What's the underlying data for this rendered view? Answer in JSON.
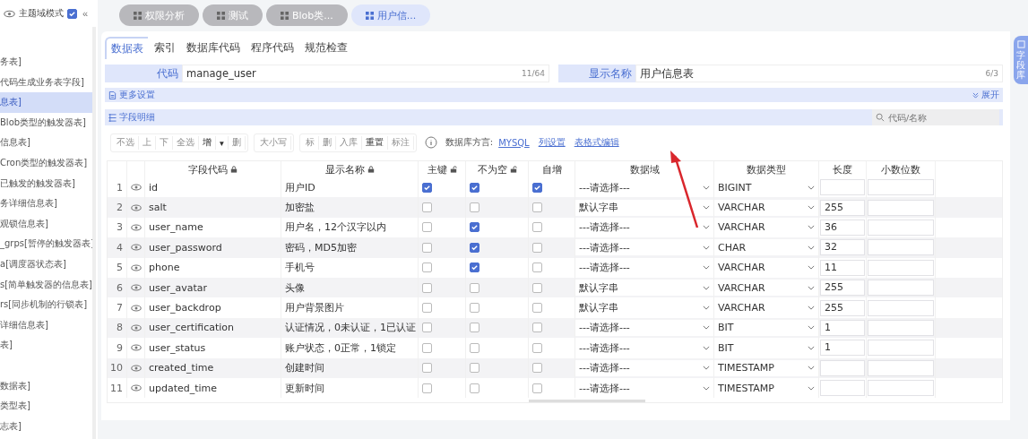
{
  "sidebar": {
    "header": {
      "label": "主题域模式",
      "checked": true,
      "collapse": "«"
    },
    "items": [
      {
        "label": "务表]",
        "selected": false
      },
      {
        "label": "代码生成业务表字段]",
        "selected": false
      },
      {
        "label": "息表]",
        "selected": true
      },
      {
        "label": "Blob类型的触发器表]",
        "selected": false
      },
      {
        "label": "信息表]",
        "selected": false
      },
      {
        "label": "Cron类型的触发器表]",
        "selected": false
      },
      {
        "label": "已触发的触发器表]",
        "selected": false
      },
      {
        "label": "务详细信息表]",
        "selected": false
      },
      {
        "label": "观锁信息表]",
        "selected": false
      },
      {
        "label": "_grps[暂停的触发器表]",
        "selected": false
      },
      {
        "label": "a[调度器状态表]",
        "selected": false
      },
      {
        "label": "s[简单触发器的信息表]",
        "selected": false
      },
      {
        "label": "rs[同步机制的行锁表]",
        "selected": false
      },
      {
        "label": "详细信息表]",
        "selected": false
      },
      {
        "label": "表]",
        "selected": false
      }
    ],
    "lower_items": [
      {
        "label": "数据表]",
        "selected": false
      },
      {
        "label": "类型表]",
        "selected": false
      },
      {
        "label": "志表]",
        "selected": false
      }
    ]
  },
  "open_tabs": [
    {
      "label": "权限分析",
      "selected": false
    },
    {
      "label": "测试",
      "selected": false
    },
    {
      "label": "Blob类...",
      "selected": false
    },
    {
      "label": "用户信...",
      "selected": true
    }
  ],
  "sub_tabs": [
    {
      "label": "数据表",
      "selected": true
    },
    {
      "label": "索引",
      "selected": false
    },
    {
      "label": "数据库代码",
      "selected": false
    },
    {
      "label": "程序代码",
      "selected": false
    },
    {
      "label": "规范检查",
      "selected": false
    }
  ],
  "form": [
    {
      "label": "代码",
      "value": "manage_user",
      "counter": "11/64"
    },
    {
      "label": "显示名称",
      "value": "用户信息表",
      "counter": "6/3"
    }
  ],
  "side_tab": {
    "label": "字段库"
  },
  "more_settings": {
    "label": "更多设置",
    "expand": "展开"
  },
  "field_details": {
    "label": "字段明细",
    "search_placeholder": "代码/名称"
  },
  "toolbar": {
    "groups": [
      [
        {
          "label": "不选",
          "disabled": true
        },
        {
          "label": "上",
          "disabled": true
        },
        {
          "label": "下",
          "disabled": true
        },
        {
          "label": "全选",
          "disabled": true
        },
        {
          "label": "增",
          "disabled": false
        },
        {
          "label": "▾",
          "disabled": false
        },
        {
          "label": "删",
          "disabled": true
        }
      ],
      [
        {
          "label": "大小写",
          "disabled": true
        }
      ],
      [
        {
          "label": "标",
          "disabled": true
        },
        {
          "label": "删",
          "disabled": true
        },
        {
          "label": "入库",
          "disabled": true
        },
        {
          "label": "重置",
          "disabled": false
        },
        {
          "label": "标注",
          "disabled": true
        }
      ]
    ],
    "dialect_label": "数据库方言:",
    "dialect": "MYSQL",
    "links": [
      "列设置",
      "表格式编辑"
    ]
  },
  "table": {
    "columns": [
      "字段代码",
      "显示名称",
      "主键",
      "不为空",
      "自增",
      "数据域",
      "数据类型",
      "长度",
      "小数位数"
    ],
    "rows": [
      {
        "no": "1",
        "code": "id",
        "name": "用户ID",
        "pk": true,
        "not_null": true,
        "auto_inc": true,
        "domain": "---请选择---",
        "type": "BIGINT",
        "length": ""
      },
      {
        "no": "2",
        "code": "salt",
        "name": "加密盐",
        "pk": false,
        "not_null": false,
        "auto_inc": false,
        "domain": "默认字串",
        "type": "VARCHAR",
        "length": "255"
      },
      {
        "no": "3",
        "code": "user_name",
        "name": "用户名，12个汉字以内",
        "pk": false,
        "not_null": true,
        "auto_inc": false,
        "domain": "---请选择---",
        "type": "VARCHAR",
        "length": "36"
      },
      {
        "no": "4",
        "code": "user_password",
        "name": "密码，MD5加密",
        "pk": false,
        "not_null": true,
        "auto_inc": false,
        "domain": "---请选择---",
        "type": "CHAR",
        "length": "32"
      },
      {
        "no": "5",
        "code": "phone",
        "name": "手机号",
        "pk": false,
        "not_null": true,
        "auto_inc": false,
        "domain": "---请选择---",
        "type": "VARCHAR",
        "length": "11"
      },
      {
        "no": "6",
        "code": "user_avatar",
        "name": "头像",
        "pk": false,
        "not_null": false,
        "auto_inc": false,
        "domain": "默认字串",
        "type": "VARCHAR",
        "length": "255"
      },
      {
        "no": "7",
        "code": "user_backdrop",
        "name": "用户背景图片",
        "pk": false,
        "not_null": false,
        "auto_inc": false,
        "domain": "默认字串",
        "type": "VARCHAR",
        "length": "255"
      },
      {
        "no": "8",
        "code": "user_certification",
        "name": "认证情况，0未认证，1已认证",
        "pk": false,
        "not_null": false,
        "auto_inc": false,
        "domain": "---请选择---",
        "type": "BIT",
        "length": "1"
      },
      {
        "no": "9",
        "code": "user_status",
        "name": "账户状态，0正常，1锁定",
        "pk": false,
        "not_null": false,
        "auto_inc": false,
        "domain": "---请选择---",
        "type": "BIT",
        "length": "1"
      },
      {
        "no": "10",
        "code": "created_time",
        "name": "创建时间",
        "pk": false,
        "not_null": false,
        "auto_inc": false,
        "domain": "---请选择---",
        "type": "TIMESTAMP",
        "length": ""
      },
      {
        "no": "11",
        "code": "updated_time",
        "name": "更新时间",
        "pk": false,
        "not_null": false,
        "auto_inc": false,
        "domain": "---请选择---",
        "type": "TIMESTAMP",
        "length": ""
      }
    ]
  },
  "annotation": {
    "kind": "arrow"
  }
}
